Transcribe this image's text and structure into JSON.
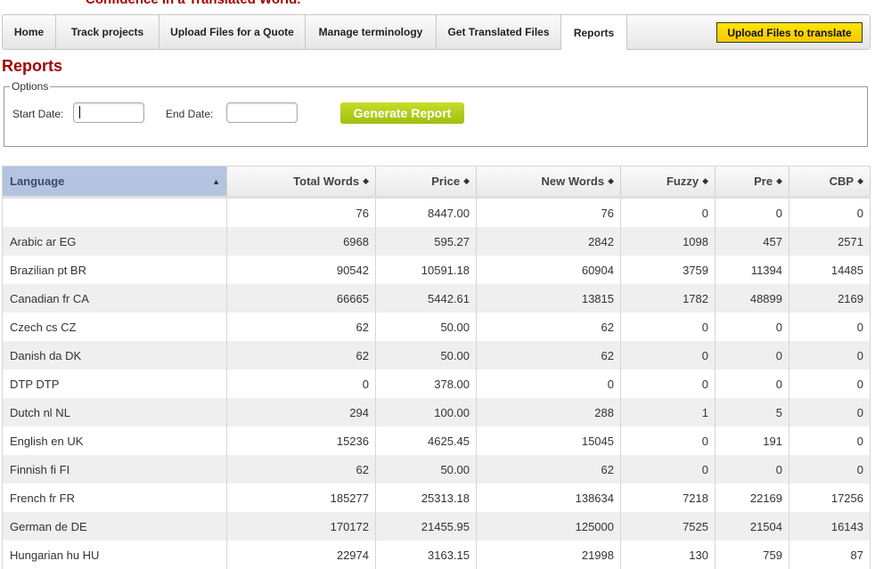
{
  "header": {
    "tagline": "Confidence in a Translated World."
  },
  "nav": {
    "tabs": [
      {
        "label": "Home",
        "active": false
      },
      {
        "label": "Track projects",
        "active": false
      },
      {
        "label": "Upload Files for a Quote",
        "active": false
      },
      {
        "label": "Manage terminology",
        "active": false
      },
      {
        "label": "Get Translated Files",
        "active": false
      },
      {
        "label": "Reports",
        "active": true
      }
    ],
    "upload_button": "Upload Files to translate"
  },
  "page": {
    "title": "Reports"
  },
  "options": {
    "legend": "Options",
    "start_label": "Start Date:",
    "start_value": "",
    "end_label": "End Date:",
    "end_value": "",
    "generate_button": "Generate Report"
  },
  "table": {
    "headers": [
      "Language",
      "Total Words",
      "Price",
      "New Words",
      "Fuzzy",
      "Pre",
      "CBP"
    ],
    "sort_icons": {
      "language": "sort-asc-icon",
      "others": "sort-both-icon"
    },
    "rows": [
      [
        "",
        "76",
        "8447.00",
        "76",
        "0",
        "0",
        "0"
      ],
      [
        "Arabic ar EG",
        "6968",
        "595.27",
        "2842",
        "1098",
        "457",
        "2571"
      ],
      [
        "Brazilian pt BR",
        "90542",
        "10591.18",
        "60904",
        "3759",
        "11394",
        "14485"
      ],
      [
        "Canadian fr CA",
        "66665",
        "5442.61",
        "13815",
        "1782",
        "48899",
        "2169"
      ],
      [
        "Czech cs CZ",
        "62",
        "50.00",
        "62",
        "0",
        "0",
        "0"
      ],
      [
        "Danish da DK",
        "62",
        "50.00",
        "62",
        "0",
        "0",
        "0"
      ],
      [
        "DTP DTP",
        "0",
        "378.00",
        "0",
        "0",
        "0",
        "0"
      ],
      [
        "Dutch nl NL",
        "294",
        "100.00",
        "288",
        "1",
        "5",
        "0"
      ],
      [
        "English en UK",
        "15236",
        "4625.45",
        "15045",
        "0",
        "191",
        "0"
      ],
      [
        "Finnish fi FI",
        "62",
        "50.00",
        "62",
        "0",
        "0",
        "0"
      ],
      [
        "French fr FR",
        "185277",
        "25313.18",
        "138634",
        "7218",
        "22169",
        "17256"
      ],
      [
        "German de DE",
        "170172",
        "21455.95",
        "125000",
        "7525",
        "21504",
        "16143"
      ],
      [
        "Hungarian hu HU",
        "22974",
        "3163.15",
        "21998",
        "130",
        "759",
        "87"
      ]
    ]
  },
  "colors": {
    "brand_red": "#a40000",
    "upload_yellow": "#ffe600",
    "generate_green": "#a8c414",
    "sorted_header": "#b4c4e0"
  }
}
